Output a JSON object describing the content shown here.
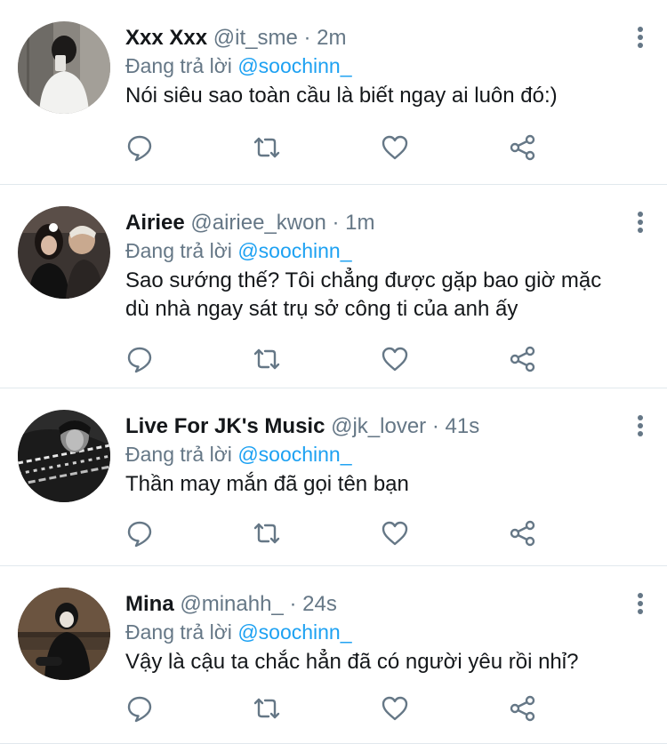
{
  "tweets": [
    {
      "name": "Xxx Xxx",
      "handle": "@it_sme",
      "separator": "·",
      "time": "2m",
      "reply_prefix": "Đang trả lời",
      "reply_to": "@soochinn_",
      "text": "Nói siêu sao toàn cầu là biết ngay ai luôn đó:)"
    },
    {
      "name": "Airiee",
      "handle": "@airiee_kwon",
      "separator": "·",
      "time": "1m",
      "reply_prefix": "Đang trả lời",
      "reply_to": "@soochinn_",
      "text": "Sao sướng thế? Tôi chẳng được gặp bao giờ mặc dù nhà ngay sát trụ sở công ti của anh ấy"
    },
    {
      "name": "Live For JK's Music",
      "handle": "@jk_lover",
      "separator": "·",
      "time": "41s",
      "reply_prefix": "Đang trả lời",
      "reply_to": "@soochinn_",
      "text": "Thần may mắn đã gọi tên bạn"
    },
    {
      "name": "Mina",
      "handle": "@minahh_",
      "separator": "·",
      "time": "24s",
      "reply_prefix": "Đang trả lời",
      "reply_to": "@soochinn_",
      "text": "Vậy là cậu ta chắc hẳn đã có người yêu rồi nhỉ?"
    }
  ],
  "colors": {
    "mention": "#1da1f2",
    "secondary_text": "#657786",
    "divider": "#e1e8ed"
  },
  "icons": {
    "reply": "reply-icon",
    "retweet": "retweet-icon",
    "like": "like-icon",
    "share": "share-icon",
    "more": "more-options-icon"
  }
}
